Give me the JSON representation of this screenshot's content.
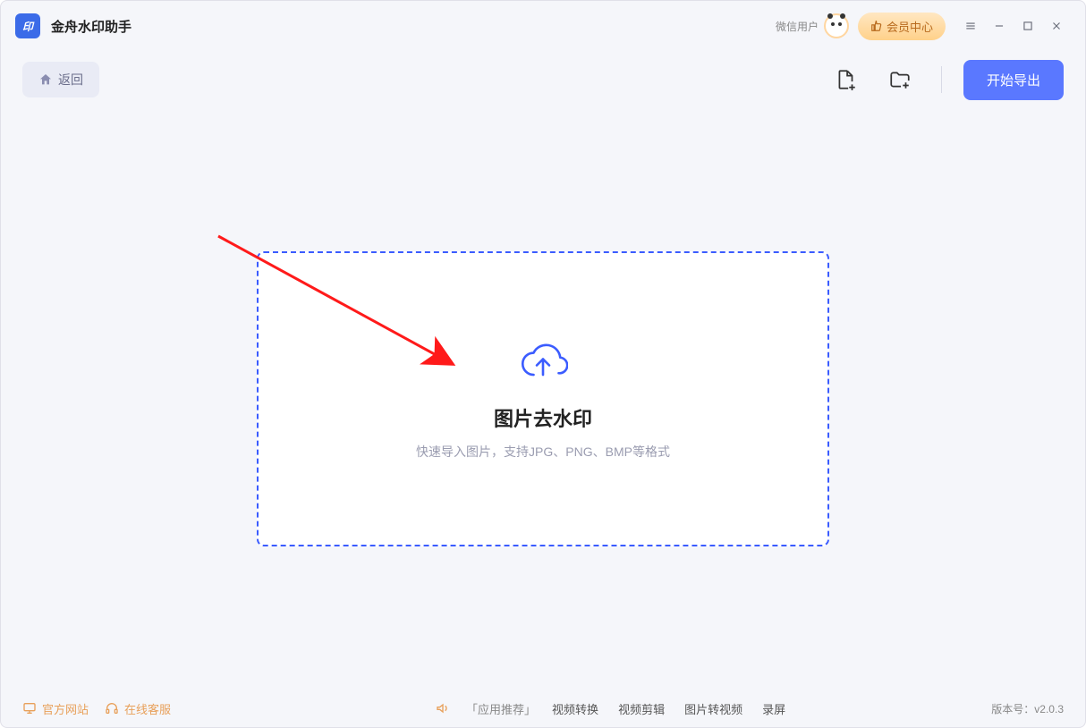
{
  "app": {
    "logo_text": "印",
    "title": "金舟水印助手"
  },
  "titlebar": {
    "user_label": "微信用户",
    "vip_label": "会员中心"
  },
  "toolbar": {
    "back_label": "返回",
    "export_label": "开始导出"
  },
  "dropzone": {
    "title": "图片去水印",
    "subtitle": "快速导入图片，支持JPG、PNG、BMP等格式"
  },
  "footer": {
    "official_site": "官方网站",
    "online_service": "在线客服",
    "recommend": "「应用推荐」",
    "tabs": [
      "视频转换",
      "视频剪辑",
      "图片转视频",
      "录屏"
    ],
    "version_label": "版本号：",
    "version_value": "v2.0.3"
  }
}
